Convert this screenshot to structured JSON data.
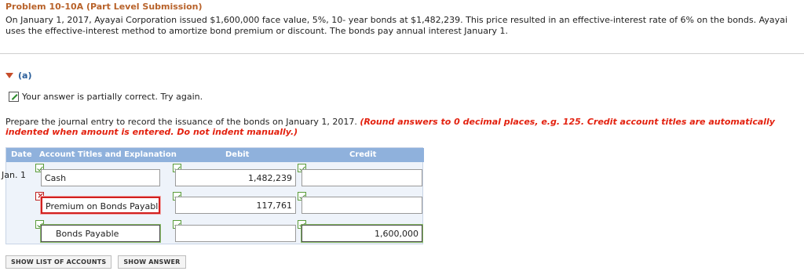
{
  "problem": {
    "title": "Problem 10-10A (Part Level Submission)",
    "text": "On January 1, 2017, Ayayai Corporation issued $1,600,000 face value, 5%, 10- year bonds at $1,482,239. This price resulted in an effective-interest rate of 6% on the bonds. Ayayai uses the effective-interest method to amortize bond premium or discount. The bonds pay annual interest January 1."
  },
  "part": {
    "label": "(a)"
  },
  "feedback": {
    "text": "Your answer is partially correct.  Try again."
  },
  "instruction": {
    "text": "Prepare the journal entry to record the issuance of the bonds on January 1, 2017.",
    "hint": "(Round answers to 0 decimal places, e.g. 125. Credit account titles are automatically indented when amount is entered. Do not indent manually.)"
  },
  "journal": {
    "headers": {
      "date": "Date",
      "account": "Account Titles and Explanation",
      "debit": "Debit",
      "credit": "Credit"
    },
    "date": "Jan. 1",
    "rows": [
      {
        "account": "Cash",
        "debit": "1,482,239",
        "credit": ""
      },
      {
        "account": "Premium on Bonds Payable",
        "debit": "117,761",
        "credit": ""
      },
      {
        "account": "Bonds Payable",
        "debit": "",
        "credit": "1,600,000"
      }
    ]
  },
  "buttons": {
    "show_list": "SHOW LIST OF ACCOUNTS",
    "show_answer": "SHOW ANSWER"
  },
  "colors": {
    "title": "#b8622a",
    "hint": "#e3210f",
    "header_bg": "#8fb1dc",
    "error": "#d2201f",
    "correct": "#3c8a25"
  }
}
